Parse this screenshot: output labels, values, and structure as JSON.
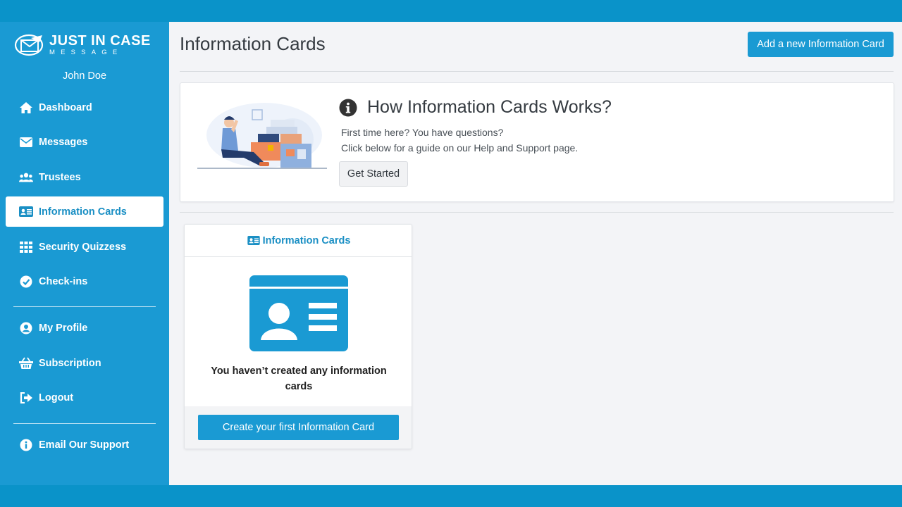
{
  "brand": {
    "title": "JUST IN CASE",
    "subtitle": "MESSAGE"
  },
  "user": {
    "name": "John Doe"
  },
  "sidebar": {
    "items": [
      {
        "label": "Dashboard",
        "icon": "home-icon"
      },
      {
        "label": "Messages",
        "icon": "envelope-icon"
      },
      {
        "label": "Trustees",
        "icon": "users-icon"
      },
      {
        "label": "Information Cards",
        "icon": "id-card-icon",
        "active": true
      },
      {
        "label": "Security Quizzess",
        "icon": "grid-icon"
      },
      {
        "label": "Check-ins",
        "icon": "check-circle-icon"
      }
    ],
    "account_items": [
      {
        "label": "My Profile",
        "icon": "user-circle-icon"
      },
      {
        "label": "Subscription",
        "icon": "basket-icon"
      },
      {
        "label": "Logout",
        "icon": "sign-out-icon"
      }
    ],
    "support_items": [
      {
        "label": "Email Our Support",
        "icon": "info-circle-icon"
      }
    ]
  },
  "main": {
    "title": "Information Cards",
    "add_button": "Add a new Information Card",
    "how": {
      "title": "How Information Cards Works?",
      "line1": "First time here? You have questions?",
      "line2": "Click below for a guide on our Help and Support page.",
      "button": "Get Started"
    },
    "card": {
      "header": "Information Cards",
      "empty_text": "You haven’t created any information cards",
      "create_button": "Create your first Information Card"
    }
  },
  "colors": {
    "brand_blue": "#1a9ad3",
    "frame_blue": "#0a93c9",
    "background": "#f3f4f7"
  }
}
